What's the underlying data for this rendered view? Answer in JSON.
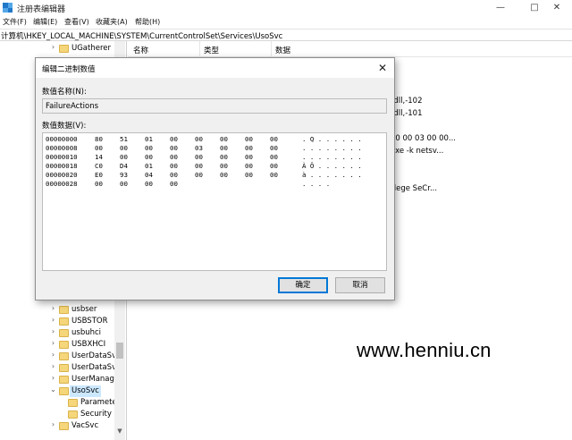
{
  "window": {
    "title": "注册表编辑器",
    "min_glyph": "—",
    "max_glyph": "□",
    "close_glyph": "✕"
  },
  "menu": [
    "文件(F)",
    "编辑(E)",
    "查看(V)",
    "收藏夹(A)",
    "帮助(H)"
  ],
  "address": "计算机\\HKEY_LOCAL_MACHINE\\SYSTEM\\CurrentControlSet\\Services\\UsoSvc",
  "tree": {
    "top_items": [
      {
        "label": "UGatherer",
        "chev": "›"
      }
    ],
    "bottom_items": [
      {
        "label": "usbser",
        "chev": "›"
      },
      {
        "label": "USBSTOR",
        "chev": "›"
      },
      {
        "label": "usbuhci",
        "chev": "›"
      },
      {
        "label": "USBXHCI",
        "chev": "›"
      },
      {
        "label": "UserDataSvc",
        "chev": "›"
      },
      {
        "label": "UserDataSvc_",
        "chev": "›"
      },
      {
        "label": "UserManager",
        "chev": "›"
      },
      {
        "label": "UsoSvc",
        "chev": "⌄"
      },
      {
        "label": "Parameters",
        "chev": ""
      },
      {
        "label": "Security",
        "chev": ""
      },
      {
        "label": "VacSvc",
        "chev": "›"
      }
    ]
  },
  "list": {
    "col_name": "名称",
    "col_type": "类型",
    "col_data": "数据",
    "visible_fragments": [
      "c.dll,-102",
      "c.dll,-101",
      "00 00 03 00 00...",
      "exe -k netsv...",
      "ivilege SeCr..."
    ]
  },
  "dialog": {
    "title": "编辑二进制数值",
    "close_glyph": "✕",
    "name_label": "数值名称(N):",
    "name_value": "FailureActions",
    "data_label": "数值数据(V):",
    "rows": [
      {
        "addr": "00000000",
        "bytes": [
          "80",
          "51",
          "01",
          "00",
          "00",
          "00",
          "00",
          "00"
        ],
        "ascii": ". Q . . . . . ."
      },
      {
        "addr": "00000008",
        "bytes": [
          "00",
          "00",
          "00",
          "00",
          "03",
          "00",
          "00",
          "00"
        ],
        "ascii": ". . . . . . . ."
      },
      {
        "addr": "00000010",
        "bytes": [
          "14",
          "00",
          "00",
          "00",
          "00",
          "00",
          "00",
          "00"
        ],
        "ascii": ". . . . . . . ."
      },
      {
        "addr": "00000018",
        "bytes": [
          "C0",
          "D4",
          "01",
          "00",
          "00",
          "00",
          "00",
          "00"
        ],
        "ascii": "À Ô . . . . . ."
      },
      {
        "addr": "00000020",
        "bytes": [
          "E0",
          "93",
          "04",
          "00",
          "00",
          "00",
          "00",
          "00"
        ],
        "ascii": "à . . . . . . ."
      },
      {
        "addr": "00000028",
        "bytes": [
          "00",
          "00",
          "00",
          "00"
        ],
        "ascii": ". . . ."
      }
    ],
    "ok_label": "确定",
    "cancel_label": "取消"
  },
  "watermark": "www.henniu.cn",
  "colors": {
    "selection": "#cce8ff",
    "folder": "#f5d67a",
    "default_button_border": "#0078d7"
  }
}
